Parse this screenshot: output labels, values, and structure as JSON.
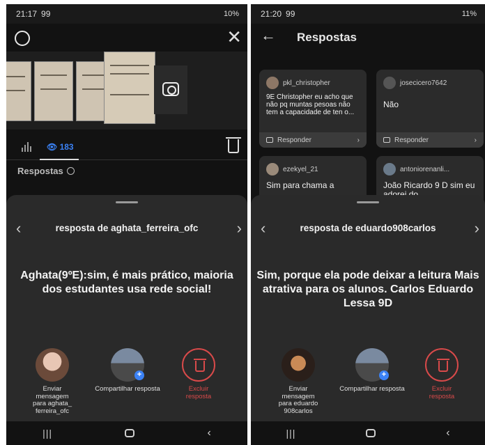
{
  "left": {
    "status": {
      "time": "21:17",
      "signal_text": "99",
      "battery": "10%"
    },
    "tabs": {
      "views_count": "183"
    },
    "section": {
      "title": "Respostas"
    },
    "sheet": {
      "title": "resposta de aghata_ferreira_ofc",
      "answer": "Aghata(9ºE):sim, é mais prático, maioria dos estudantes usa rede social!",
      "actions": {
        "send_label": "Enviar mensagem para aghata_ ferreira_ofc",
        "share_label": "Compartilhar resposta",
        "delete_label": "Excluir resposta"
      }
    }
  },
  "right": {
    "status": {
      "time": "21:20",
      "signal_text": "99",
      "battery": "11%"
    },
    "header": {
      "title": "Respostas"
    },
    "cards": [
      {
        "user": "pkl_christopher",
        "text": "9E Christopher eu acho que não pq muntas pesoas não tem a capacidade de ten o...",
        "reply": "Responder"
      },
      {
        "user": "josecicero7642",
        "text": "Não",
        "reply": "Responder"
      },
      {
        "user": "ezekyel_21",
        "text": "Sim para chama a"
      },
      {
        "user": "antoniorenanli...",
        "text": "João Ricardo 9 D sim eu adorei do"
      }
    ],
    "sheet": {
      "title": "resposta de eduardo908carlos",
      "answer": "Sim, porque ela pode deixar a leitura Mais atrativa para os alunos. Carlos Eduardo Lessa 9D",
      "actions": {
        "send_label": "Enviar mensagem para eduardo 908carlos",
        "share_label": "Compartilhar resposta",
        "delete_label": "Excluir resposta"
      }
    }
  },
  "colors": {
    "accent": "#3b82f6",
    "danger": "#d94a4a",
    "sheet_bg": "#2a2a2a",
    "bg": "#121212"
  }
}
